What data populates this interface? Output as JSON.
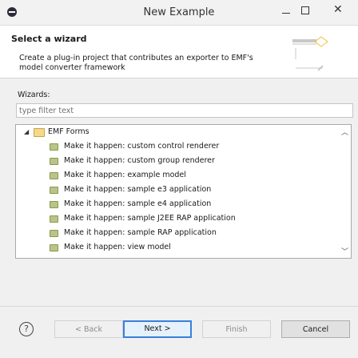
{
  "window": {
    "title": "New Example"
  },
  "banner": {
    "title": "Select a wizard",
    "description": "Create a plug-in project that contributes an exporter to EMF's model converter framework"
  },
  "wizards": {
    "label": "Wizards:",
    "filter_placeholder": "type filter text",
    "folder": {
      "label": "EMF Forms",
      "expanded": true
    },
    "items": [
      "Make it happen: custom control renderer",
      "Make it happen: custom group renderer",
      "Make it happen: example model",
      "Make it happen: sample e3 application",
      "Make it happen: sample e4 application",
      "Make it happen: sample J2EE RAP application",
      "Make it happen: sample RAP application",
      "Make it happen: view model"
    ]
  },
  "buttons": {
    "help": "?",
    "back": "< Back",
    "next": "Next >",
    "finish": "Finish",
    "cancel": "Cancel"
  },
  "icons": {
    "app": "eclipse-icon",
    "folder": "folder-icon",
    "item": "wizard-item-icon"
  }
}
